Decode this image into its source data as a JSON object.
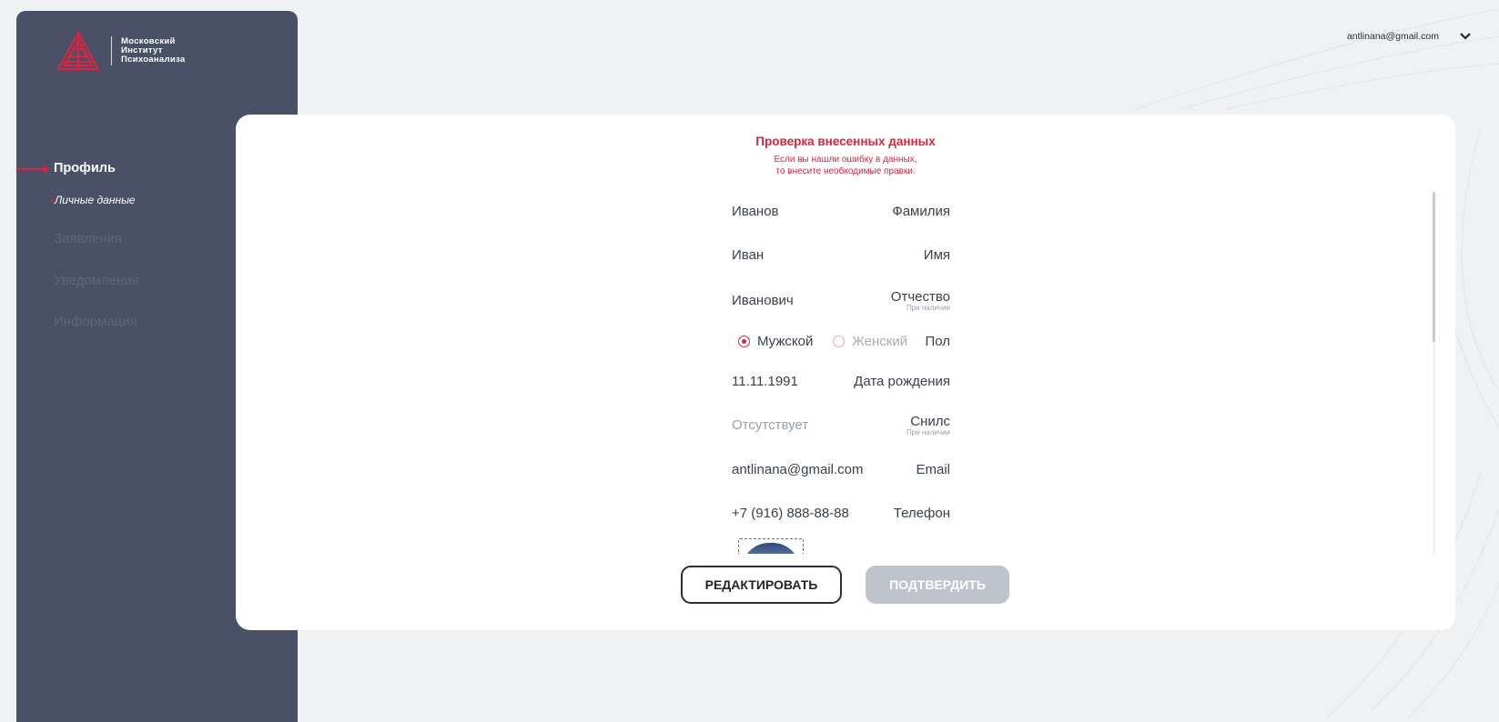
{
  "brand": {
    "logo_lines": [
      "Московский",
      "Институт",
      "Психоанализа"
    ],
    "accent_color": "#e5203a",
    "sidebar_color": "#4a5167"
  },
  "header": {
    "user_email": "antlinana@gmail.com",
    "menu_icon": "chevron-down-icon"
  },
  "sidebar": {
    "active_item": "Профиль",
    "active_subitem": "Личные данные",
    "items": [
      "Заявления",
      "Уведомления",
      "Информация"
    ]
  },
  "card": {
    "title": "Проверка внесенных данных",
    "subtitle_lines": [
      "Если вы нашли ошибку в данных,",
      "то внесите необходимые правки."
    ]
  },
  "fields": {
    "surname": {
      "label": "Фамилия",
      "value": "Иванов"
    },
    "name": {
      "label": "Имя",
      "value": "Иван"
    },
    "patronymic": {
      "label": "Отчество",
      "note": "При наличии",
      "value": "Иванович"
    },
    "gender": {
      "label": "Пол",
      "options": [
        "Мужской",
        "Женский"
      ],
      "selected": "Мужской"
    },
    "birthdate": {
      "label": "Дата рождения",
      "value": "11.11.1991"
    },
    "snils": {
      "label": "Снилс",
      "note": "При наличии",
      "value": "Отсутствует"
    },
    "email": {
      "label": "Email",
      "value": "antlinana@gmail.com"
    },
    "phone": {
      "label": "Телефон",
      "value": "+7 (916) 888-88-88"
    }
  },
  "buttons": {
    "edit": "РЕДАКТИРОВАТЬ",
    "confirm": "ПОДТВЕРДИТЬ"
  }
}
